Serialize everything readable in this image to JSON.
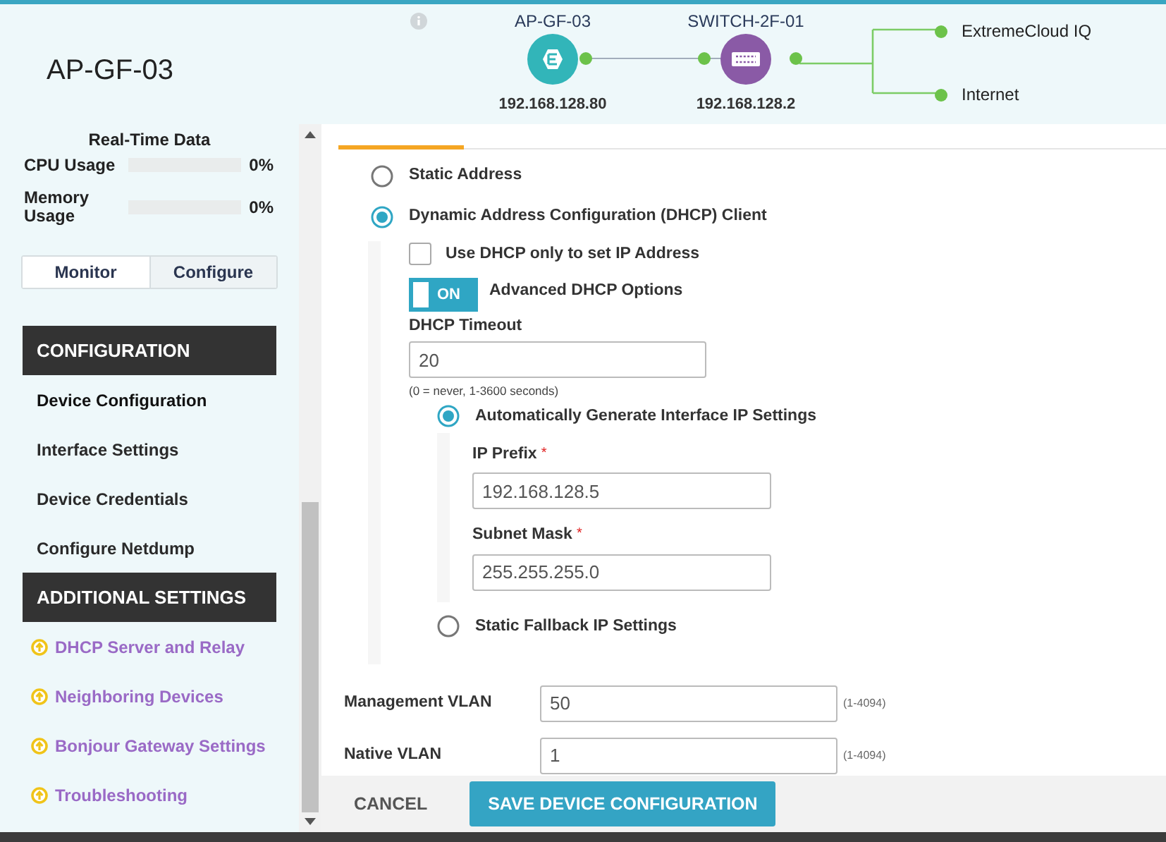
{
  "header": {
    "title": "AP-GF-03"
  },
  "topology": {
    "nodes": [
      {
        "label": "AP-GF-03",
        "ip": "192.168.128.80",
        "kind": "ap"
      },
      {
        "label": "SWITCH-2F-01",
        "ip": "192.168.128.2",
        "kind": "switch"
      }
    ],
    "uplinks": [
      "ExtremeCloud IQ",
      "Internet"
    ]
  },
  "sidebar": {
    "realtime_title": "Real-Time Data",
    "meters": [
      {
        "label": "CPU Usage",
        "level": 0,
        "reading": "0%"
      },
      {
        "label": "Memory Usage",
        "level": 0,
        "reading": "0%"
      }
    ],
    "mode_tabs": [
      {
        "label": "Monitor",
        "selected": true
      },
      {
        "label": "Configure",
        "selected": false
      }
    ],
    "sections": [
      {
        "title": "CONFIGURATION",
        "items": [
          {
            "label": "Device Configuration",
            "selected": true,
            "kind": "plain"
          },
          {
            "label": "Interface Settings",
            "selected": false,
            "kind": "plain"
          },
          {
            "label": "Device Credentials",
            "selected": false,
            "kind": "plain"
          },
          {
            "label": "Configure Netdump",
            "selected": false,
            "kind": "plain"
          }
        ]
      },
      {
        "title": "ADDITIONAL SETTINGS",
        "items": [
          {
            "label": "DHCP Server and Relay",
            "selected": false,
            "kind": "upgrade"
          },
          {
            "label": "Neighboring Devices",
            "selected": false,
            "kind": "upgrade"
          },
          {
            "label": "Bonjour Gateway Settings",
            "selected": false,
            "kind": "upgrade"
          },
          {
            "label": "Troubleshooting",
            "selected": false,
            "kind": "upgrade"
          }
        ]
      }
    ]
  },
  "form": {
    "address_mode": [
      {
        "label": "Static Address",
        "selected": false
      },
      {
        "label": "Dynamic Address Configuration (DHCP) Client",
        "selected": true
      }
    ],
    "dhcp_only": {
      "label": "Use DHCP only to set IP Address",
      "checked": false
    },
    "advanced_toggle": {
      "state_label": "ON",
      "on": true,
      "label": "Advanced DHCP Options"
    },
    "dhcp_timeout": {
      "label": "DHCP Timeout",
      "value": "20",
      "hint": "(0 = never, 1-3600 seconds)"
    },
    "ip_settings": [
      {
        "label": "Automatically Generate Interface IP Settings",
        "selected": true
      },
      {
        "label": "Static Fallback IP Settings",
        "selected": false
      }
    ],
    "auto_fields": [
      {
        "label": "IP Prefix",
        "required_mark": "*",
        "value": "192.168.128.5"
      },
      {
        "label": "Subnet Mask",
        "required_mark": "*",
        "value": "255.255.255.0"
      }
    ],
    "vlans": [
      {
        "label": "Management VLAN",
        "value": "50",
        "range": "(1-4094)"
      },
      {
        "label": "Native VLAN",
        "value": "1",
        "range": "(1-4094)"
      }
    ]
  },
  "footer": {
    "buttons": [
      {
        "label": "CANCEL",
        "kind": "secondary"
      },
      {
        "label": "SAVE DEVICE CONFIGURATION",
        "kind": "primary"
      }
    ]
  }
}
